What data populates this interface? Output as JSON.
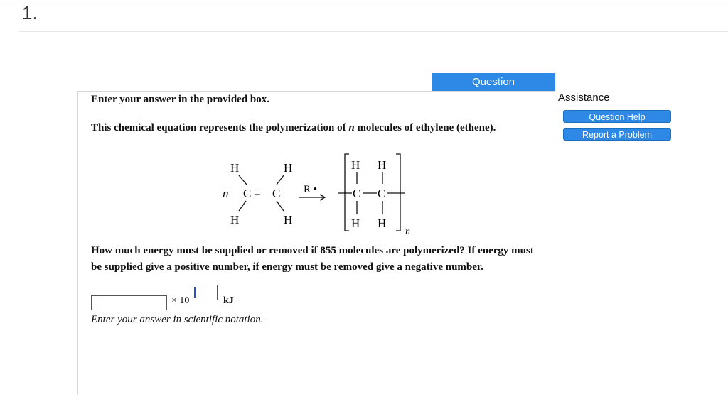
{
  "question_number": "1.",
  "question_tab": "Question",
  "assistance": {
    "title": "Assistance",
    "buttons": [
      "Question Help",
      "Report a Problem"
    ]
  },
  "question": {
    "instruction": "Enter your answer in the provided box.",
    "intro_before": "This chemical equation represents the polymerization of ",
    "intro_var": "n",
    "intro_after": " molecules of ethylene (ethene).",
    "prompt": "How much energy must be supplied or removed if 855 molecules are polymerized? If energy must be supplied give a positive number, if energy must be removed give a negative number."
  },
  "equation": {
    "coefficient": "n",
    "atom_h": "H",
    "atom_c": "C",
    "double_bond": "=",
    "initiator": "R •",
    "subscript": "n"
  },
  "answer": {
    "mantissa_value": "",
    "times_label": "× 10",
    "exponent_value": "",
    "unit": "kJ",
    "hint": "Enter your answer in scientific notation."
  }
}
